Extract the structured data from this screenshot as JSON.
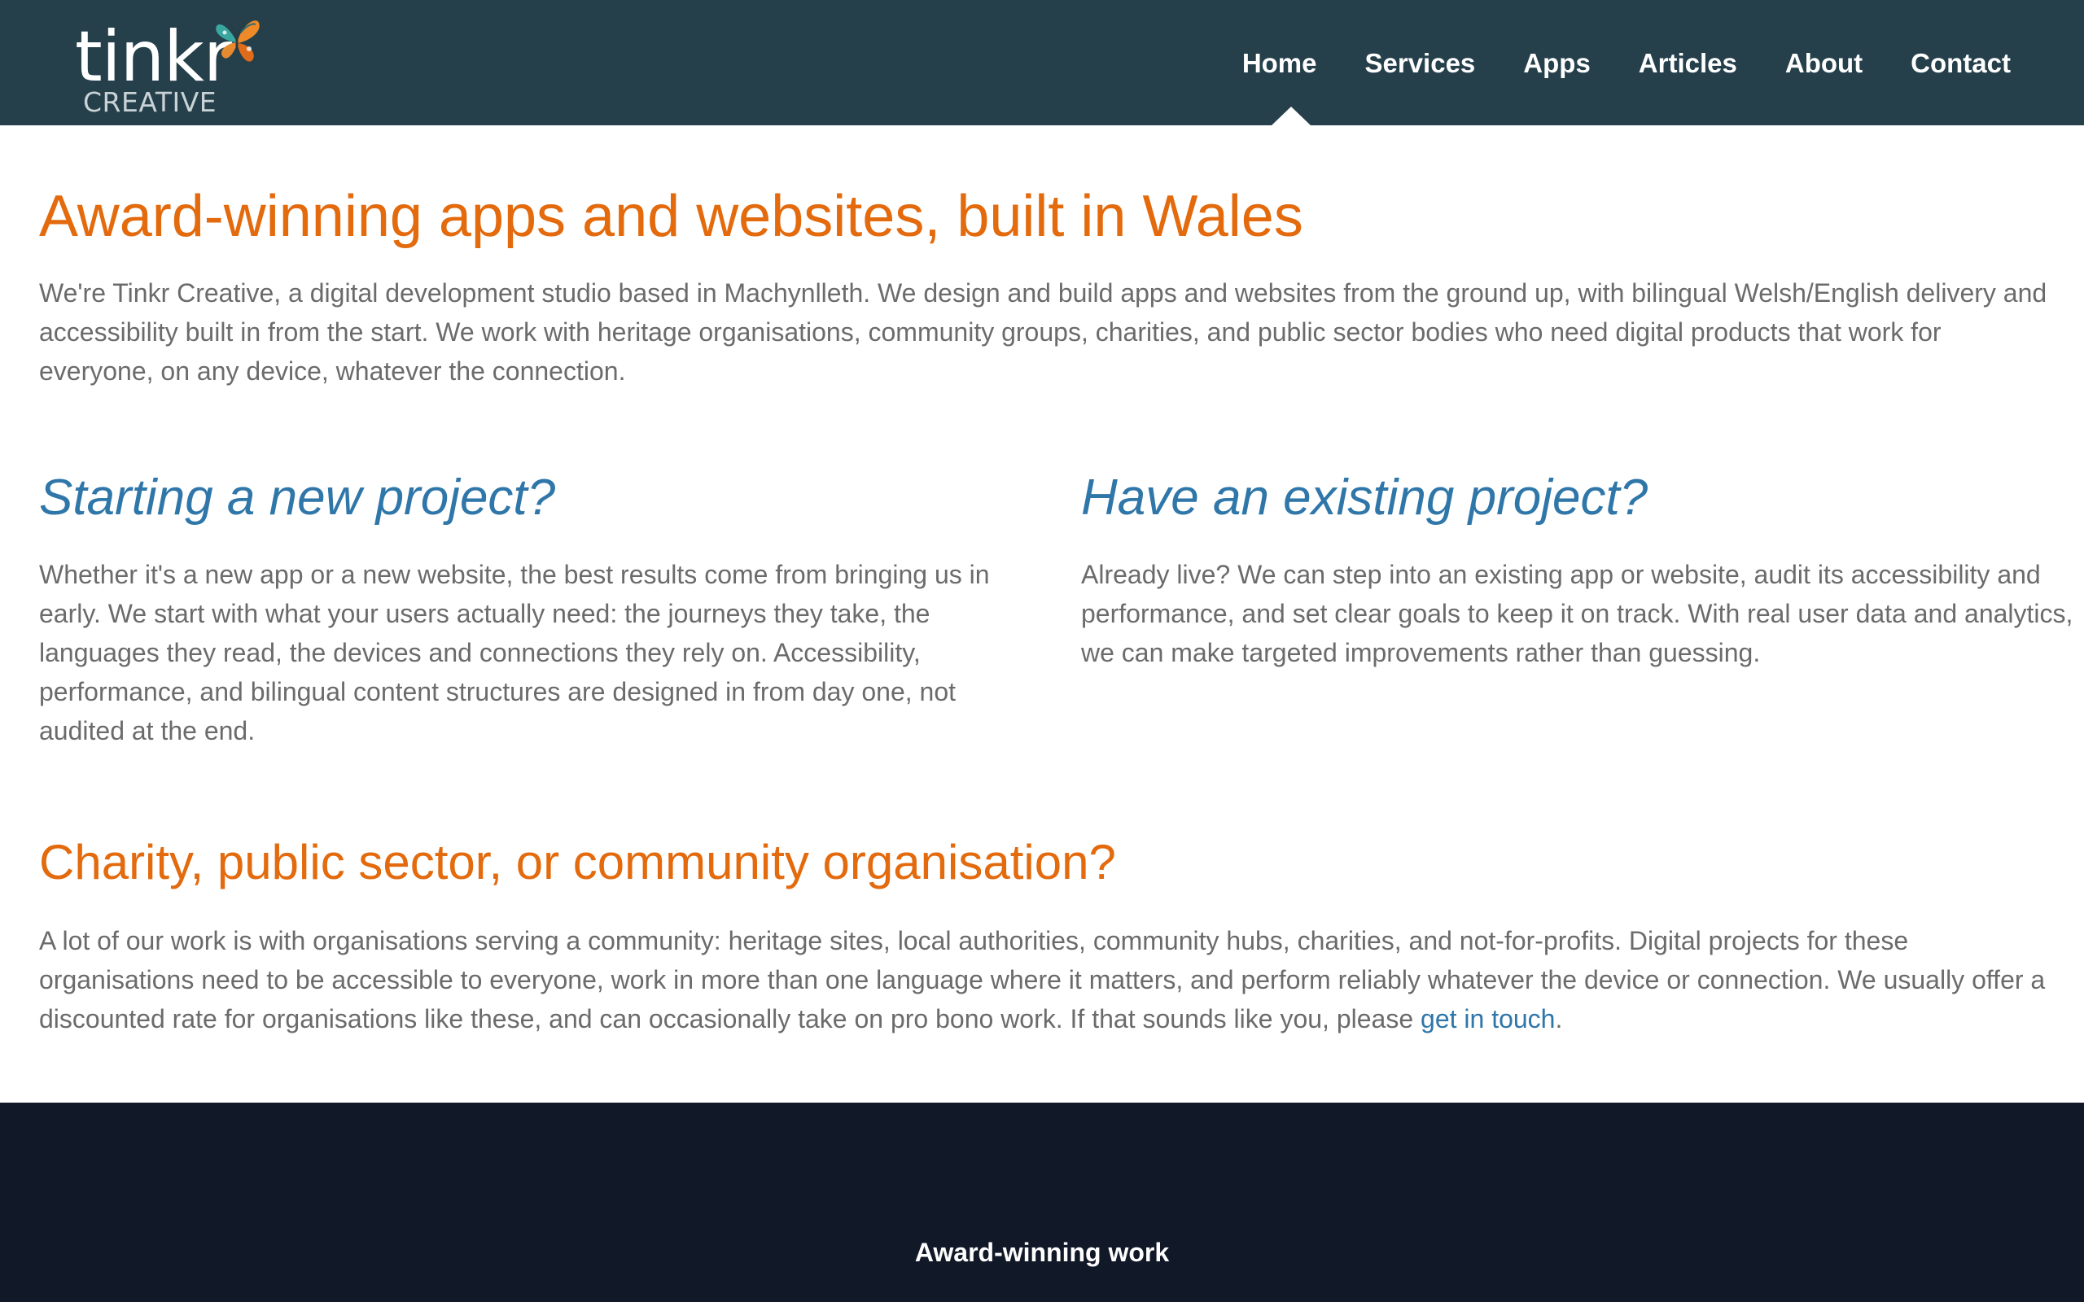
{
  "header": {
    "logo": {
      "word": "tinkr",
      "sub": "CREATIVE",
      "icon": "butterfly-icon"
    },
    "nav": [
      {
        "label": "Home",
        "active": true
      },
      {
        "label": "Services"
      },
      {
        "label": "Apps"
      },
      {
        "label": "Articles"
      },
      {
        "label": "About"
      },
      {
        "label": "Contact"
      }
    ],
    "background": "#25404b"
  },
  "hero": {
    "title": "Award-winning apps and websites, built in Wales",
    "intro": "We're Tinkr Creative, a digital development studio based in Machynlleth. We design and build apps and websites from the ground up, with bilingual Welsh/English delivery and accessibility built in from the start. We work with heritage organisations, community groups, charities, and public sector bodies who need digital products that work for everyone, on any device, whatever the connection."
  },
  "columns": [
    {
      "title": "Starting a new project?",
      "body": "Whether it's a new app or a new website, the best results come from bringing us in early. We start with what your users actually need: the journeys they take, the languages they read, the devices and connections they rely on. Accessibility, performance, and bilingual content structures are designed in from day one, not audited at the end."
    },
    {
      "title": "Have an existing project?",
      "body": "Already live? We can step into an existing app or website, audit its accessibility and performance, and set clear goals to keep it on track. With real user data and analytics, we can make targeted improvements rather than guessing."
    }
  ],
  "charity": {
    "title": "Charity, public sector, or community organisation?",
    "body": "A lot of our work is with organisations serving a community: heritage sites, local authorities, community hubs, charities, and not-for-profits. Digital projects for these organisations need to be accessible to everyone, work in more than one language where it matters, and perform reliably whatever the device or connection. We usually offer a discounted rate for organisations like these, and can occasionally take on pro bono work. If that sounds like you, please ",
    "link": "get in touch",
    "after_link": "."
  },
  "footer": {
    "title": "Award-winning work",
    "background": "#111827"
  },
  "colors": {
    "accent_orange": "#e36a0d",
    "accent_blue": "#2f76a9",
    "body_text": "#6b6b6b"
  }
}
